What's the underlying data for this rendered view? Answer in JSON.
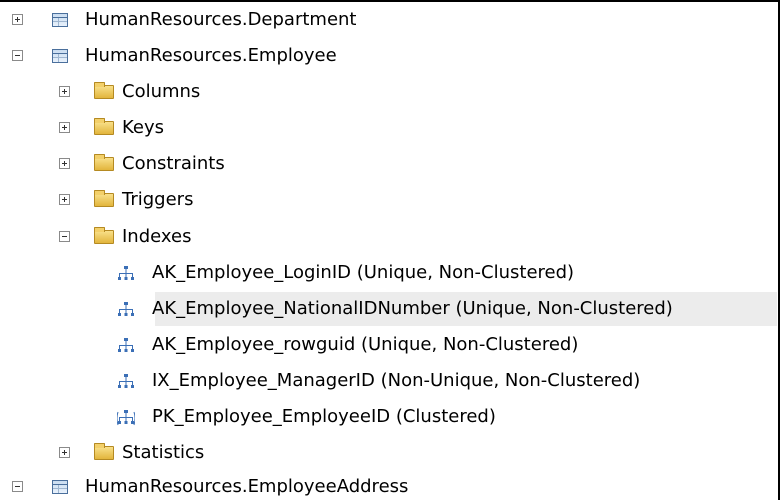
{
  "tree": {
    "tables": [
      {
        "label": "HumanResources.Department",
        "expanded": false
      },
      {
        "label": "HumanResources.Employee",
        "expanded": true
      },
      {
        "label": "HumanResources.EmployeeAddress",
        "expanded": true
      }
    ],
    "employee_children": [
      {
        "label": "Columns",
        "expanded": false
      },
      {
        "label": "Keys",
        "expanded": false
      },
      {
        "label": "Constraints",
        "expanded": false
      },
      {
        "label": "Triggers",
        "expanded": false
      },
      {
        "label": "Indexes",
        "expanded": true
      }
    ],
    "indexes": [
      {
        "label": "AK_Employee_LoginID (Unique, Non-Clustered)",
        "icon": "nonclustered-index-icon"
      },
      {
        "label": "AK_Employee_NationalIDNumber (Unique, Non-Clustered)",
        "icon": "nonclustered-index-icon",
        "selected": true
      },
      {
        "label": "AK_Employee_rowguid (Unique, Non-Clustered)",
        "icon": "nonclustered-index-icon"
      },
      {
        "label": "IX_Employee_ManagerID (Non-Unique, Non-Clustered)",
        "icon": "nonclustered-index-icon"
      },
      {
        "label": "PK_Employee_EmployeeID (Clustered)",
        "icon": "clustered-index-icon"
      }
    ],
    "statistics": {
      "label": "Statistics",
      "expanded": false
    }
  },
  "colors": {
    "selection": "#ececec",
    "index_icon": "#3b6fb6",
    "folder": "#e8c04a",
    "table_icon": "#4a6f9c"
  }
}
